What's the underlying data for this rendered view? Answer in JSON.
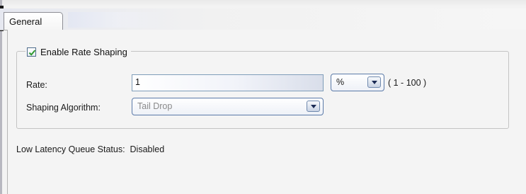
{
  "tabs": [
    {
      "label": "General",
      "active": true
    }
  ],
  "rate_shaping": {
    "enable_label": "Enable Rate Shaping",
    "enabled": true
  },
  "rate": {
    "label": "Rate:",
    "value": "1",
    "unit": "%",
    "range_hint": "( 1 - 100 )"
  },
  "shaping_algorithm": {
    "label": "Shaping Algorithm:",
    "value": "Tail Drop",
    "disabled": true
  },
  "low_latency": {
    "label": "Low Latency Queue Status:",
    "value": "Disabled"
  },
  "colors": {
    "panel_bg": "#f4f4f4",
    "input_border": "#7f9db9",
    "combo_border": "#5b7aa8",
    "check_mark": "#2f9a2f",
    "disabled_text": "#8a8a8a"
  },
  "icons": [
    "checkmark-icon",
    "dropdown-arrow-icon"
  ]
}
